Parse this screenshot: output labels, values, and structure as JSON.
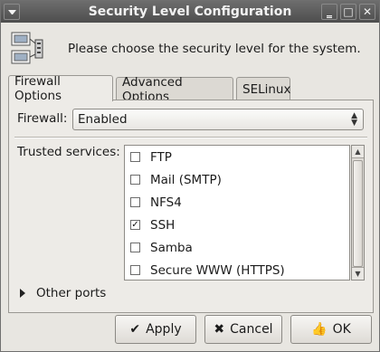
{
  "window": {
    "title": "Security Level Configuration"
  },
  "header": {
    "text": "Please choose the security level for the system."
  },
  "tabs": [
    {
      "label": "Firewall Options",
      "active": true,
      "underline": "F"
    },
    {
      "label": "Advanced Options",
      "active": false,
      "underline": "d"
    },
    {
      "label": "SELinux",
      "active": false,
      "underline": "S"
    }
  ],
  "firewall": {
    "label": "Firewall:",
    "value": "Enabled"
  },
  "trusted_services": {
    "label": "Trusted services:",
    "items": [
      {
        "label": "FTP",
        "checked": false
      },
      {
        "label": "Mail (SMTP)",
        "checked": false
      },
      {
        "label": "NFS4",
        "checked": false
      },
      {
        "label": "SSH",
        "checked": true
      },
      {
        "label": "Samba",
        "checked": false
      },
      {
        "label": "Secure WWW (HTTPS)",
        "checked": false
      }
    ]
  },
  "other_ports": {
    "label": "Other ports"
  },
  "buttons": {
    "apply": "Apply",
    "cancel": "Cancel",
    "ok": "OK"
  }
}
